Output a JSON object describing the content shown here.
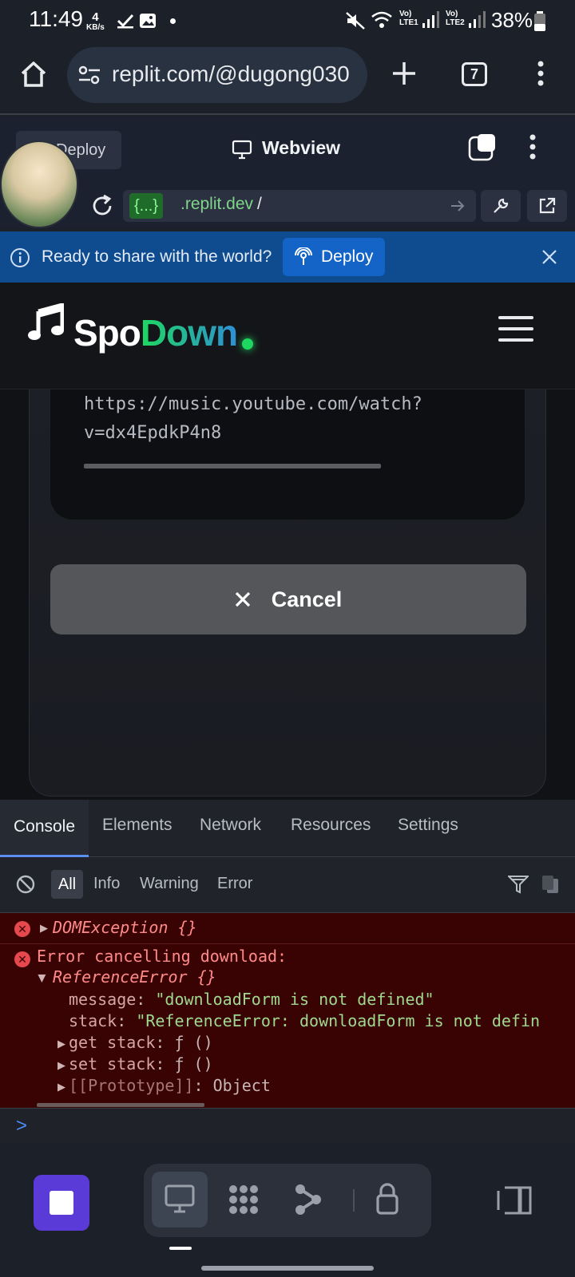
{
  "status_bar": {
    "time": "11:49",
    "net_speed_value": "4",
    "net_speed_unit": "KB/s",
    "sim1": "Vo) LTE1",
    "sim2": "Vo) LTE2",
    "battery": "38%"
  },
  "browser": {
    "url": "replit.com/@dugong030",
    "tab_count": "7"
  },
  "webview_header": {
    "deploy_label": "Deploy",
    "title": "Webview",
    "url_tag": "{...}",
    "url_domain": ".replit.dev",
    "url_path": "/"
  },
  "deploy_banner": {
    "text": "Ready to share with the world?",
    "button_label": "Deploy"
  },
  "app": {
    "logo_part1": "Spo",
    "logo_part2": "Down",
    "download_url": "https://music.youtube.com/watch?v=dx4EpdkP4n8",
    "cancel_label": "Cancel",
    "progress": 0
  },
  "devtools": {
    "tabs": [
      "Console",
      "Elements",
      "Network",
      "Resources",
      "Settings"
    ],
    "filters": [
      "All",
      "Info",
      "Warning",
      "Error"
    ],
    "log": {
      "entry1": "DOMException {}",
      "entry2_title": "Error cancelling download:",
      "entry2_type": "ReferenceError {}",
      "message_key": "message",
      "message_value": "\"downloadForm is not defined\"",
      "stack_key": "stack",
      "stack_value": "\"ReferenceError: downloadForm is not defin",
      "get_stack": "get stack",
      "set_stack": "set stack",
      "func": "ƒ ()",
      "proto_key": "[[Prototype]]",
      "proto_value": "Object"
    },
    "prompt": ">"
  },
  "colors": {
    "accent_green": "#1ed760",
    "deploy_banner": "#0f4b8f",
    "error_bg": "#3a0303",
    "stop_button": "#5a3bd8"
  }
}
